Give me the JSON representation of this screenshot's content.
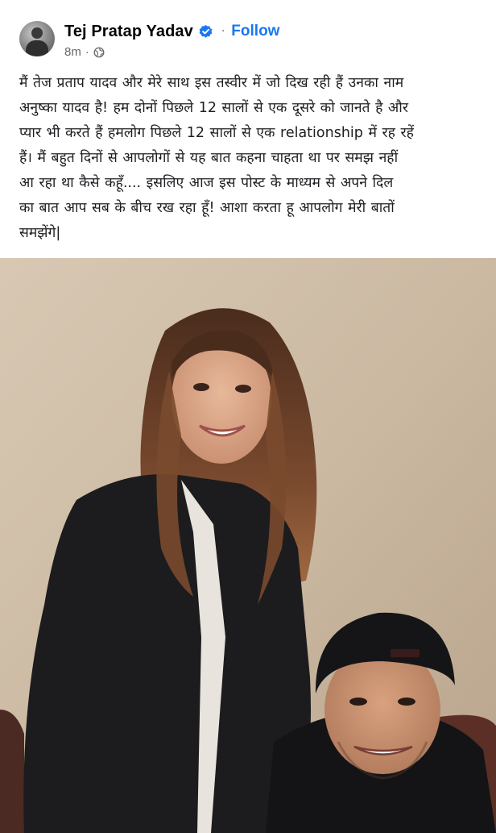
{
  "post": {
    "author": {
      "name": "Tej Pratap Yadav",
      "verified_icon": "verified-badge-icon",
      "avatar_icon": "avatar-icon"
    },
    "follow_label": "Follow",
    "separator": "·",
    "timestamp": "8m",
    "meta_separator": "·",
    "audience_icon": "globe-icon",
    "caption_lines": [
      "मैं तेज प्रताप यादव और  मेरे साथ इस तस्वीर में जो दिख रही हैं उनका नाम",
      "अनुष्का यादव है! हम दोनों पिछले 12 सालों से एक दूसरे को जानते है और",
      "प्यार भी करते हैं हमलोग पिछले 12 सालों से एक relationship में रह रहें",
      "हैं। मैं बहुत दिनों से आपलोगों से यह बात कहना चाहता था पर समझ नहीं",
      "आ रहा था कैसे कहूँ.... इसलिए आज इस पोस्ट के माध्यम से अपने दिल",
      "का बात आप सब के बीच रख रहा हूँ! आशा करता हू आपलोग मेरी बातों",
      "समझेंगे|"
    ],
    "colors": {
      "follow": "#1877f2",
      "verified": "#1877f2",
      "meta_text": "#65676b",
      "name_text": "#050505"
    }
  }
}
